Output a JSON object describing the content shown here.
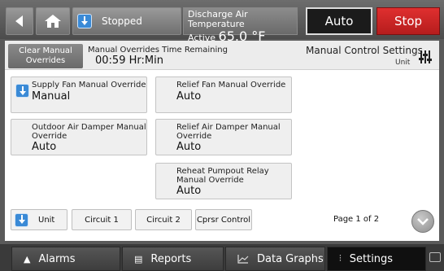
{
  "topbar": {
    "status_label": "Stopped",
    "discharge_title": "Discharge Air Temperature",
    "discharge_state": "Active",
    "discharge_value": "65.0 °F",
    "auto_label": "Auto",
    "stop_label": "Stop"
  },
  "header": {
    "clear_line1": "Clear Manual",
    "clear_line2": "Overrides",
    "remaining_label": "Manual Overrides Time Remaining",
    "remaining_value": "00:59 Hr:Min",
    "title": "Manual Control Settings",
    "subtitle": "Unit"
  },
  "cards": {
    "supply_fan": {
      "label": "Supply Fan Manual Override",
      "value": "Manual"
    },
    "relief_fan": {
      "label": "Relief Fan Manual Override",
      "value": "Auto"
    },
    "outdoor_damper": {
      "label1": "Outdoor Air Damper Manual",
      "label2": "Override",
      "value": "Auto"
    },
    "relief_damper": {
      "label1": "Relief Air Damper Manual",
      "label2": "Override",
      "value": "Auto"
    },
    "reheat_relay": {
      "label1": "Reheat Pumpout Relay",
      "label2": "Manual Override",
      "value": "Auto"
    }
  },
  "tabs": {
    "unit": "Unit",
    "circuit1": "Circuit 1",
    "circuit2": "Circuit 2",
    "cprsr": "Cprsr Control"
  },
  "pagination": {
    "text": "Page 1 of 2"
  },
  "bottom_nav": {
    "alarms": "Alarms",
    "reports": "Reports",
    "data_graphs": "Data Graphs",
    "settings": "Settings"
  },
  "colors": {
    "stop_red": "#c92222",
    "accent_blue": "#3a8ad6"
  }
}
